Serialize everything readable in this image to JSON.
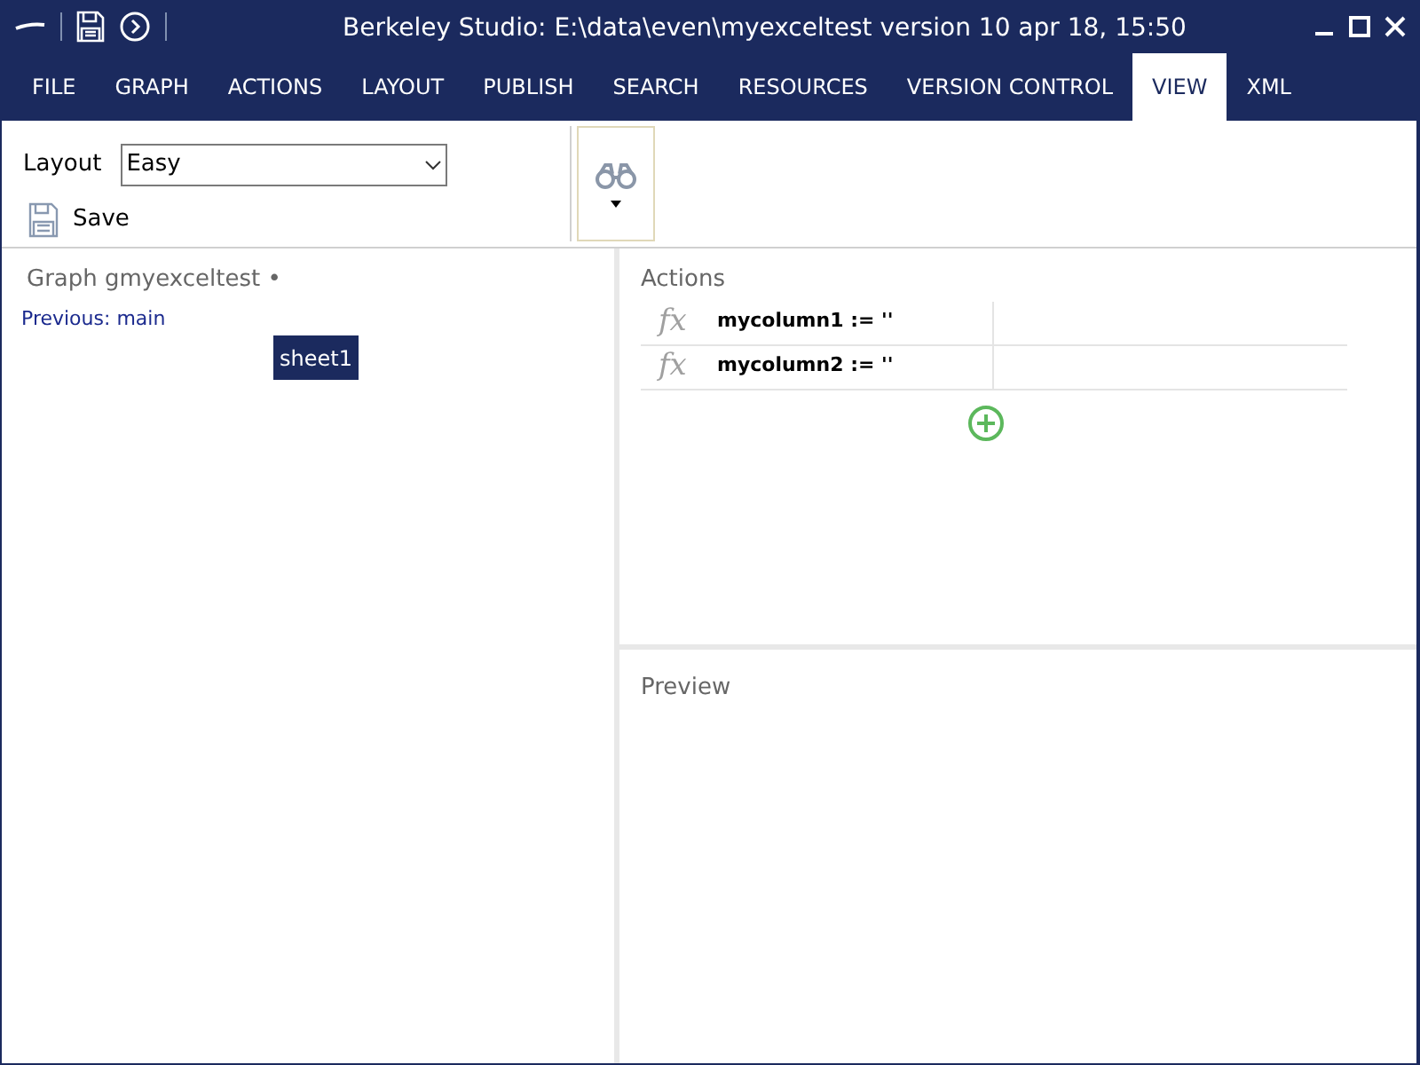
{
  "window": {
    "title": "Berkeley Studio: E:\\data\\even\\myexceltest version 10 apr 18, 15:50"
  },
  "tabs": [
    {
      "label": "FILE",
      "selected": false
    },
    {
      "label": "GRAPH",
      "selected": false
    },
    {
      "label": "ACTIONS",
      "selected": false
    },
    {
      "label": "LAYOUT",
      "selected": false
    },
    {
      "label": "PUBLISH",
      "selected": false
    },
    {
      "label": "SEARCH",
      "selected": false
    },
    {
      "label": "RESOURCES",
      "selected": false
    },
    {
      "label": "VERSION CONTROL",
      "selected": false
    },
    {
      "label": "VIEW",
      "selected": true
    },
    {
      "label": "XML",
      "selected": false
    }
  ],
  "ribbon": {
    "layout_label": "Layout",
    "layout_value": "Easy",
    "save_label": "Save"
  },
  "graph": {
    "title": "Graph gmyexceltest •",
    "previous": "Previous: main",
    "node": "sheet1"
  },
  "actions": {
    "title": "Actions",
    "items": [
      {
        "symbol": "fx",
        "text": "mycolumn1 := ''"
      },
      {
        "symbol": "fx",
        "text": "mycolumn2 := ''"
      }
    ]
  },
  "preview": {
    "title": "Preview"
  }
}
